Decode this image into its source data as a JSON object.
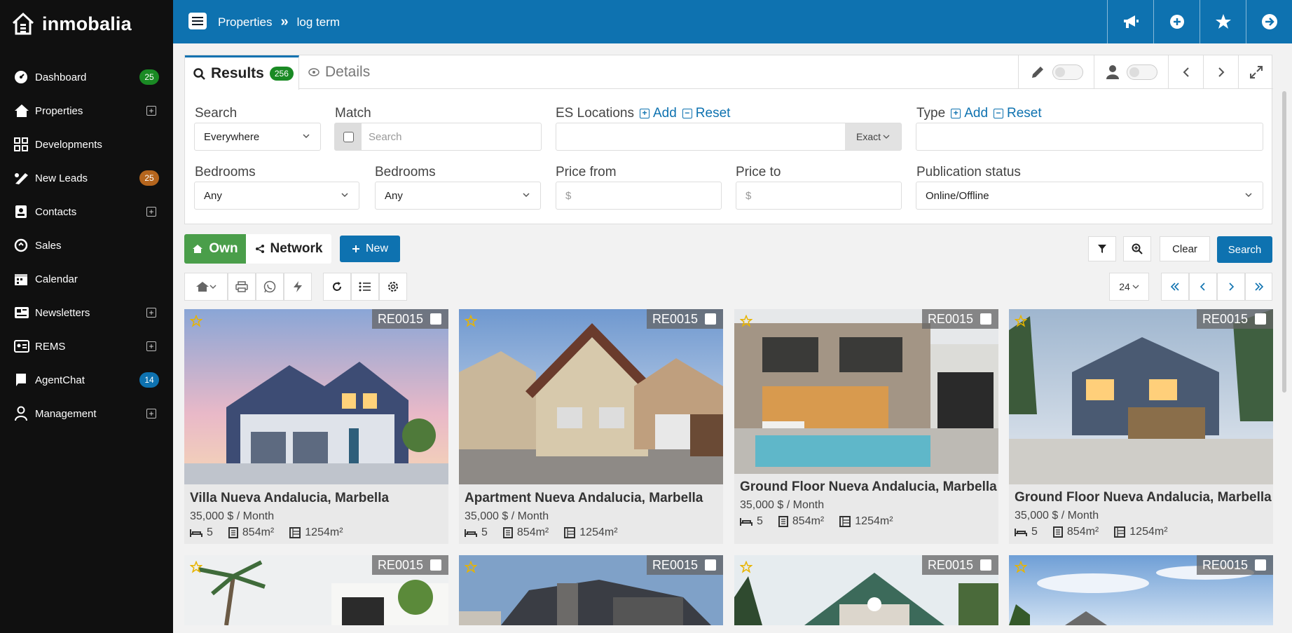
{
  "app": {
    "name": "inmobalia"
  },
  "sidebar": {
    "items": [
      {
        "label": "Dashboard",
        "icon": "dashboard-icon",
        "badge": "25",
        "badge_color": "#1a8a24"
      },
      {
        "label": "Properties",
        "icon": "house-icon",
        "plus": true
      },
      {
        "label": "Developments",
        "icon": "grid-icon"
      },
      {
        "label": "New Leads",
        "icon": "leads-icon",
        "badge": "25",
        "badge_color": "#b5651d"
      },
      {
        "label": "Contacts",
        "icon": "contacts-icon",
        "plus": true
      },
      {
        "label": "Sales",
        "icon": "sales-icon"
      },
      {
        "label": "Calendar",
        "icon": "calendar-icon"
      },
      {
        "label": "Newsletters",
        "icon": "newsletter-icon",
        "plus": true
      },
      {
        "label": "REMS",
        "icon": "rems-icon",
        "plus": true
      },
      {
        "label": "AgentChat",
        "icon": "chat-icon",
        "badge": "14",
        "badge_color": "#0e72b0"
      },
      {
        "label": "Management",
        "icon": "management-icon",
        "plus": true
      }
    ]
  },
  "topbar": {
    "crumb1": "Properties",
    "crumb_sep": "»",
    "crumb2": "log term",
    "color": "#0e72b0"
  },
  "tabs": {
    "results": "Results",
    "results_count": "256",
    "details": "Details"
  },
  "filters": {
    "search_label": "Search",
    "search_value": "Everywhere",
    "match_label": "Match",
    "match_placeholder": "Search",
    "es_locations_label": "ES Locations",
    "add": "Add",
    "reset": "Reset",
    "exact": "Exact",
    "type_label": "Type",
    "bedrooms_label": "Bedrooms",
    "bedrooms_from": "Any",
    "bedrooms_to": "Any",
    "price_from_label": "Price from",
    "price_to_label": "Price to",
    "currency": "$",
    "publication_label": "Publication status",
    "publication_value": "Online/Offline"
  },
  "actions": {
    "own": "Own",
    "network": "Network",
    "new": "New",
    "clear": "Clear",
    "search": "Search",
    "per_page": "24"
  },
  "cards": [
    {
      "ref": "RE0015",
      "title": "Villa Nueva Andalucia, Marbella",
      "price": "35,000 $ / Month",
      "beds": "5",
      "built": "854m²",
      "plot": "1254m²"
    },
    {
      "ref": "RE0015",
      "title": "Apartment Nueva Andalucia, Marbella",
      "price": "35,000 $ / Month",
      "beds": "5",
      "built": "854m²",
      "plot": "1254m²"
    },
    {
      "ref": "RE0015",
      "title": "Ground Floor Nueva Andalucia, Marbella",
      "price": "35,000 $ / Month",
      "beds": "5",
      "built": "854m²",
      "plot": "1254m²"
    },
    {
      "ref": "RE0015",
      "title": "Ground Floor Nueva Andalucia, Marbella",
      "price": "35,000 $ / Month",
      "beds": "5",
      "built": "854m²",
      "plot": "1254m²"
    }
  ],
  "cards_row2": [
    {
      "ref": "RE0015"
    },
    {
      "ref": "RE0015"
    },
    {
      "ref": "RE0015"
    },
    {
      "ref": "RE0015"
    }
  ]
}
